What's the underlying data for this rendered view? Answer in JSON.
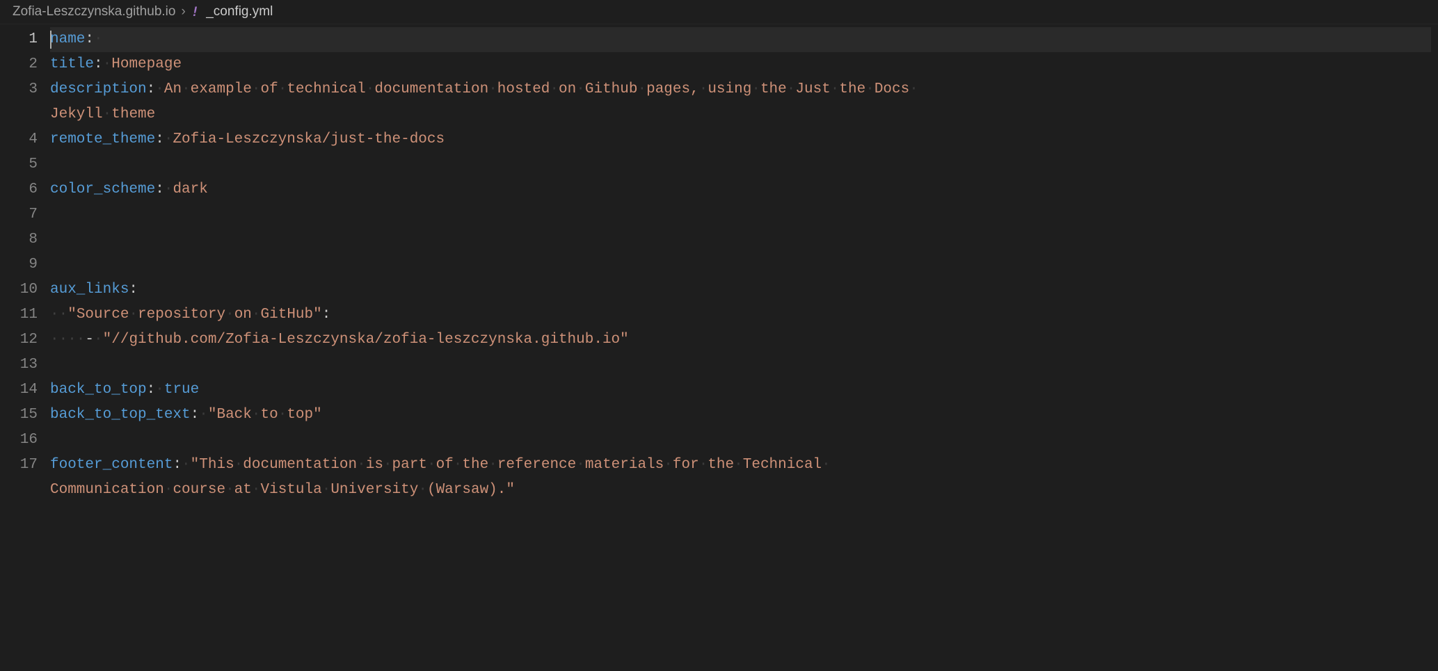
{
  "breadcrumb": {
    "folder": "Zofia-Leszczynska.github.io",
    "separator": "›",
    "icon_label": "!",
    "filename": "_config.yml"
  },
  "editor": {
    "active_line": 1,
    "lines": [
      {
        "n": 1,
        "segments": [
          {
            "t": "cursor"
          },
          {
            "t": "key",
            "v": "name"
          },
          {
            "t": "colon",
            "v": ":"
          },
          {
            "t": "ws",
            "v": "·"
          }
        ]
      },
      {
        "n": 2,
        "segments": [
          {
            "t": "key",
            "v": "title"
          },
          {
            "t": "colon",
            "v": ":"
          },
          {
            "t": "ws",
            "v": "·"
          },
          {
            "t": "str",
            "v": "Homepage"
          }
        ]
      },
      {
        "n": 3,
        "segments": [
          {
            "t": "key",
            "v": "description"
          },
          {
            "t": "colon",
            "v": ":"
          },
          {
            "t": "ws",
            "v": "·"
          },
          {
            "t": "str",
            "v": "An"
          },
          {
            "t": "ws",
            "v": "·"
          },
          {
            "t": "str",
            "v": "example"
          },
          {
            "t": "ws",
            "v": "·"
          },
          {
            "t": "str",
            "v": "of"
          },
          {
            "t": "ws",
            "v": "·"
          },
          {
            "t": "str",
            "v": "technical"
          },
          {
            "t": "ws",
            "v": "·"
          },
          {
            "t": "str",
            "v": "documentation"
          },
          {
            "t": "ws",
            "v": "·"
          },
          {
            "t": "str",
            "v": "hosted"
          },
          {
            "t": "ws",
            "v": "·"
          },
          {
            "t": "str",
            "v": "on"
          },
          {
            "t": "ws",
            "v": "·"
          },
          {
            "t": "str",
            "v": "Github"
          },
          {
            "t": "ws",
            "v": "·"
          },
          {
            "t": "str",
            "v": "pages,"
          },
          {
            "t": "ws",
            "v": "·"
          },
          {
            "t": "str",
            "v": "using"
          },
          {
            "t": "ws",
            "v": "·"
          },
          {
            "t": "str",
            "v": "the"
          },
          {
            "t": "ws",
            "v": "·"
          },
          {
            "t": "str",
            "v": "Just"
          },
          {
            "t": "ws",
            "v": "·"
          },
          {
            "t": "str",
            "v": "the"
          },
          {
            "t": "ws",
            "v": "·"
          },
          {
            "t": "str",
            "v": "Docs"
          },
          {
            "t": "ws",
            "v": "·"
          }
        ]
      },
      {
        "n": null,
        "segments": [
          {
            "t": "str",
            "v": "Jekyll"
          },
          {
            "t": "ws",
            "v": "·"
          },
          {
            "t": "str",
            "v": "theme"
          }
        ]
      },
      {
        "n": 4,
        "segments": [
          {
            "t": "key",
            "v": "remote_theme"
          },
          {
            "t": "colon",
            "v": ":"
          },
          {
            "t": "ws",
            "v": "·"
          },
          {
            "t": "str",
            "v": "Zofia-Leszczynska/just-the-docs"
          }
        ]
      },
      {
        "n": 5,
        "segments": []
      },
      {
        "n": 6,
        "segments": [
          {
            "t": "key",
            "v": "color_scheme"
          },
          {
            "t": "colon",
            "v": ":"
          },
          {
            "t": "ws",
            "v": "·"
          },
          {
            "t": "str",
            "v": "dark"
          }
        ]
      },
      {
        "n": 7,
        "segments": []
      },
      {
        "n": 8,
        "segments": []
      },
      {
        "n": 9,
        "segments": []
      },
      {
        "n": 10,
        "segments": [
          {
            "t": "key",
            "v": "aux_links"
          },
          {
            "t": "colon",
            "v": ":"
          }
        ]
      },
      {
        "n": 11,
        "segments": [
          {
            "t": "indent",
            "v": "··"
          },
          {
            "t": "str",
            "v": "\"Source"
          },
          {
            "t": "ws",
            "v": "·"
          },
          {
            "t": "str",
            "v": "repository"
          },
          {
            "t": "ws",
            "v": "·"
          },
          {
            "t": "str",
            "v": "on"
          },
          {
            "t": "ws",
            "v": "·"
          },
          {
            "t": "str",
            "v": "GitHub\""
          },
          {
            "t": "colon",
            "v": ":"
          }
        ]
      },
      {
        "n": 12,
        "segments": [
          {
            "t": "indent",
            "v": "····"
          },
          {
            "t": "punct",
            "v": "-"
          },
          {
            "t": "ws",
            "v": "·"
          },
          {
            "t": "str",
            "v": "\"//github.com/Zofia-Leszczynska/zofia-leszczynska.github.io\""
          }
        ]
      },
      {
        "n": 13,
        "segments": []
      },
      {
        "n": 14,
        "segments": [
          {
            "t": "key",
            "v": "back_to_top"
          },
          {
            "t": "colon",
            "v": ":"
          },
          {
            "t": "ws",
            "v": "·"
          },
          {
            "t": "num",
            "v": "true"
          }
        ]
      },
      {
        "n": 15,
        "segments": [
          {
            "t": "key",
            "v": "back_to_top_text"
          },
          {
            "t": "colon",
            "v": ":"
          },
          {
            "t": "ws",
            "v": "·"
          },
          {
            "t": "str",
            "v": "\"Back"
          },
          {
            "t": "ws",
            "v": "·"
          },
          {
            "t": "str",
            "v": "to"
          },
          {
            "t": "ws",
            "v": "·"
          },
          {
            "t": "str",
            "v": "top\""
          }
        ]
      },
      {
        "n": 16,
        "segments": []
      },
      {
        "n": 17,
        "segments": [
          {
            "t": "key",
            "v": "footer_content"
          },
          {
            "t": "colon",
            "v": ":"
          },
          {
            "t": "ws",
            "v": "·"
          },
          {
            "t": "str",
            "v": "\"This"
          },
          {
            "t": "ws",
            "v": "·"
          },
          {
            "t": "str",
            "v": "documentation"
          },
          {
            "t": "ws",
            "v": "·"
          },
          {
            "t": "str",
            "v": "is"
          },
          {
            "t": "ws",
            "v": "·"
          },
          {
            "t": "str",
            "v": "part"
          },
          {
            "t": "ws",
            "v": "·"
          },
          {
            "t": "str",
            "v": "of"
          },
          {
            "t": "ws",
            "v": "·"
          },
          {
            "t": "str",
            "v": "the"
          },
          {
            "t": "ws",
            "v": "·"
          },
          {
            "t": "str",
            "v": "reference"
          },
          {
            "t": "ws",
            "v": "·"
          },
          {
            "t": "str",
            "v": "materials"
          },
          {
            "t": "ws",
            "v": "·"
          },
          {
            "t": "str",
            "v": "for"
          },
          {
            "t": "ws",
            "v": "·"
          },
          {
            "t": "str",
            "v": "the"
          },
          {
            "t": "ws",
            "v": "·"
          },
          {
            "t": "str",
            "v": "Technical"
          },
          {
            "t": "ws",
            "v": "·"
          }
        ]
      },
      {
        "n": null,
        "segments": [
          {
            "t": "str",
            "v": "Communication"
          },
          {
            "t": "ws",
            "v": "·"
          },
          {
            "t": "str",
            "v": "course"
          },
          {
            "t": "ws",
            "v": "·"
          },
          {
            "t": "str",
            "v": "at"
          },
          {
            "t": "ws",
            "v": "·"
          },
          {
            "t": "str",
            "v": "Vistula"
          },
          {
            "t": "ws",
            "v": "·"
          },
          {
            "t": "str",
            "v": "University"
          },
          {
            "t": "ws",
            "v": "·"
          },
          {
            "t": "str",
            "v": "(Warsaw).\""
          }
        ]
      }
    ]
  }
}
